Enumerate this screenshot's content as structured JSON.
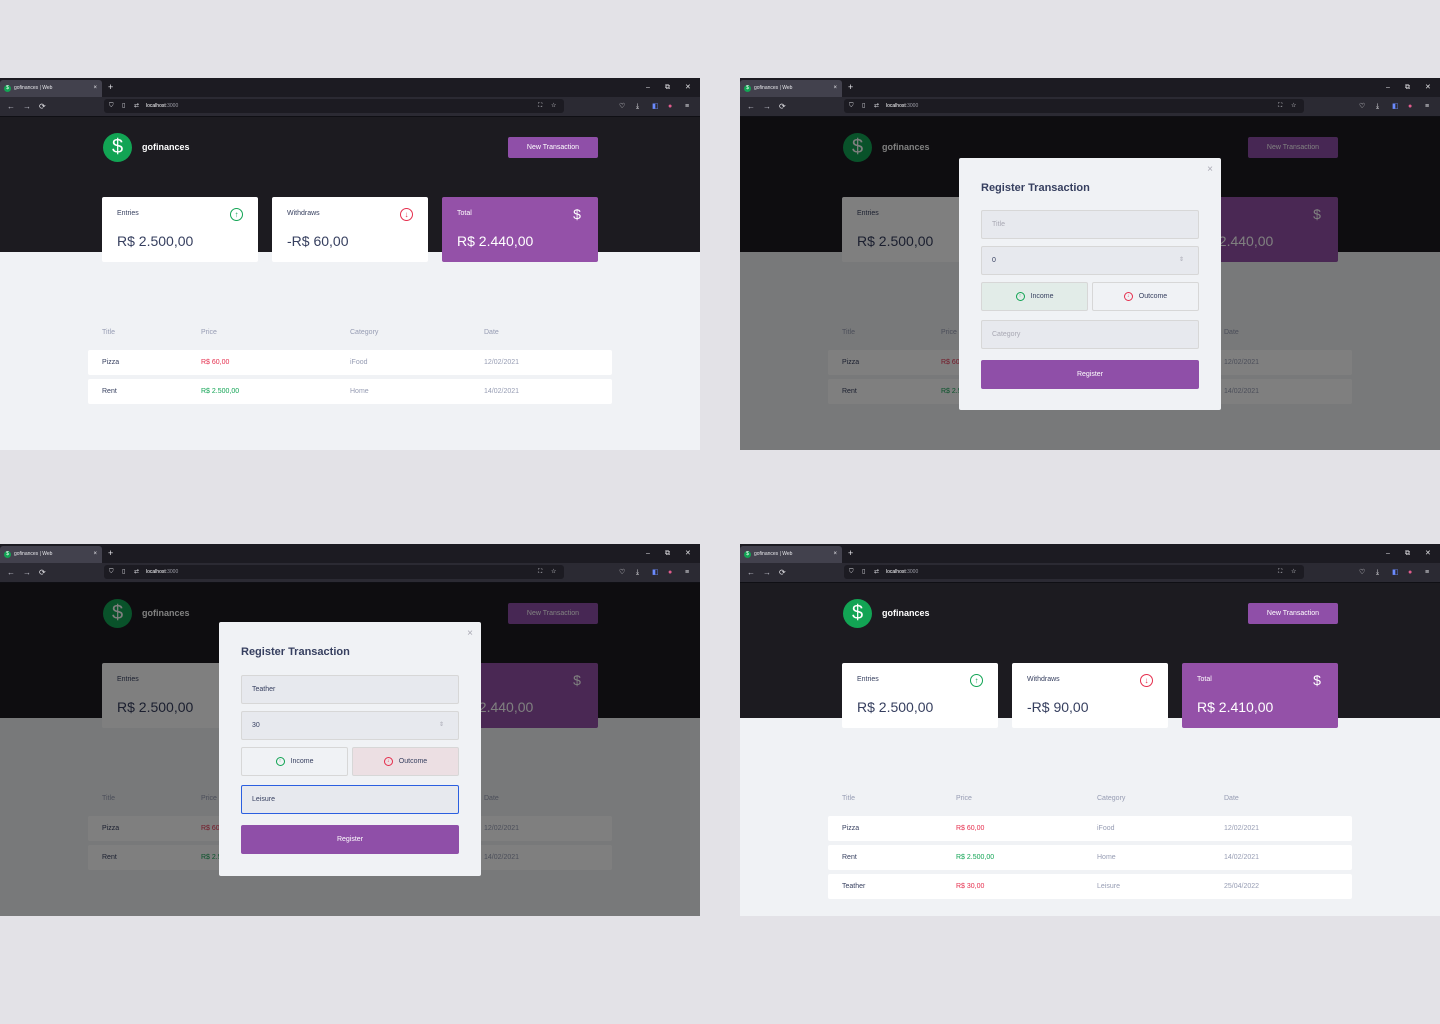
{
  "browser": {
    "tab_title": "gofinances | Web",
    "tab_close": "×",
    "new_tab": "+",
    "url_host": "localhost",
    "url_port": ":3000",
    "minimize": "–",
    "restore": "⧉",
    "close": "✕",
    "back": "←",
    "forward": "→",
    "reload": "⟳"
  },
  "app": {
    "logo_glyph": "$",
    "logo_text": "gofinances",
    "new_transaction_label": "New Transaction",
    "cards_before": {
      "entries_label": "Entries",
      "entries_value": "R$ 2.500,00",
      "withdraws_label": "Withdraws",
      "withdraws_value": "-R$ 60,00",
      "total_label": "Total",
      "total_value": "R$ 2.440,00"
    },
    "cards_after": {
      "entries_label": "Entries",
      "entries_value": "R$ 2.500,00",
      "withdraws_label": "Withdraws",
      "withdraws_value": "-R$ 90,00",
      "total_label": "Total",
      "total_value": "R$ 2.410,00"
    },
    "table_headers": {
      "title": "Title",
      "price": "Price",
      "category": "Category",
      "date": "Date"
    },
    "transactions_before": [
      {
        "title": "Pizza",
        "price": "R$ 60,00",
        "category": "iFood",
        "date": "12/02/2021"
      },
      {
        "title": "Rent",
        "price": "R$ 2.500,00",
        "category": "Home",
        "date": "14/02/2021"
      }
    ],
    "transactions_after": [
      {
        "title": "Pizza",
        "price": "R$ 60,00",
        "category": "iFood",
        "date": "12/02/2021"
      },
      {
        "title": "Rent",
        "price": "R$ 2.500,00",
        "category": "Home",
        "date": "14/02/2021"
      },
      {
        "title": "Teather",
        "price": "R$ 30,00",
        "category": "Leisure",
        "date": "25/04/2022"
      }
    ]
  },
  "modal": {
    "close": "×",
    "title": "Register Transaction",
    "title_placeholder": "Title",
    "amount_default": "0",
    "income_label": "Income",
    "outcome_label": "Outcome",
    "category_placeholder": "Category",
    "register_label": "Register",
    "filled": {
      "title": "Teather",
      "amount": "30",
      "category": "Leisure"
    }
  },
  "colors": {
    "accent": "#8f4fa8",
    "income": "#12a454",
    "outcome": "#e52e4d",
    "header": "#1c1b20"
  }
}
